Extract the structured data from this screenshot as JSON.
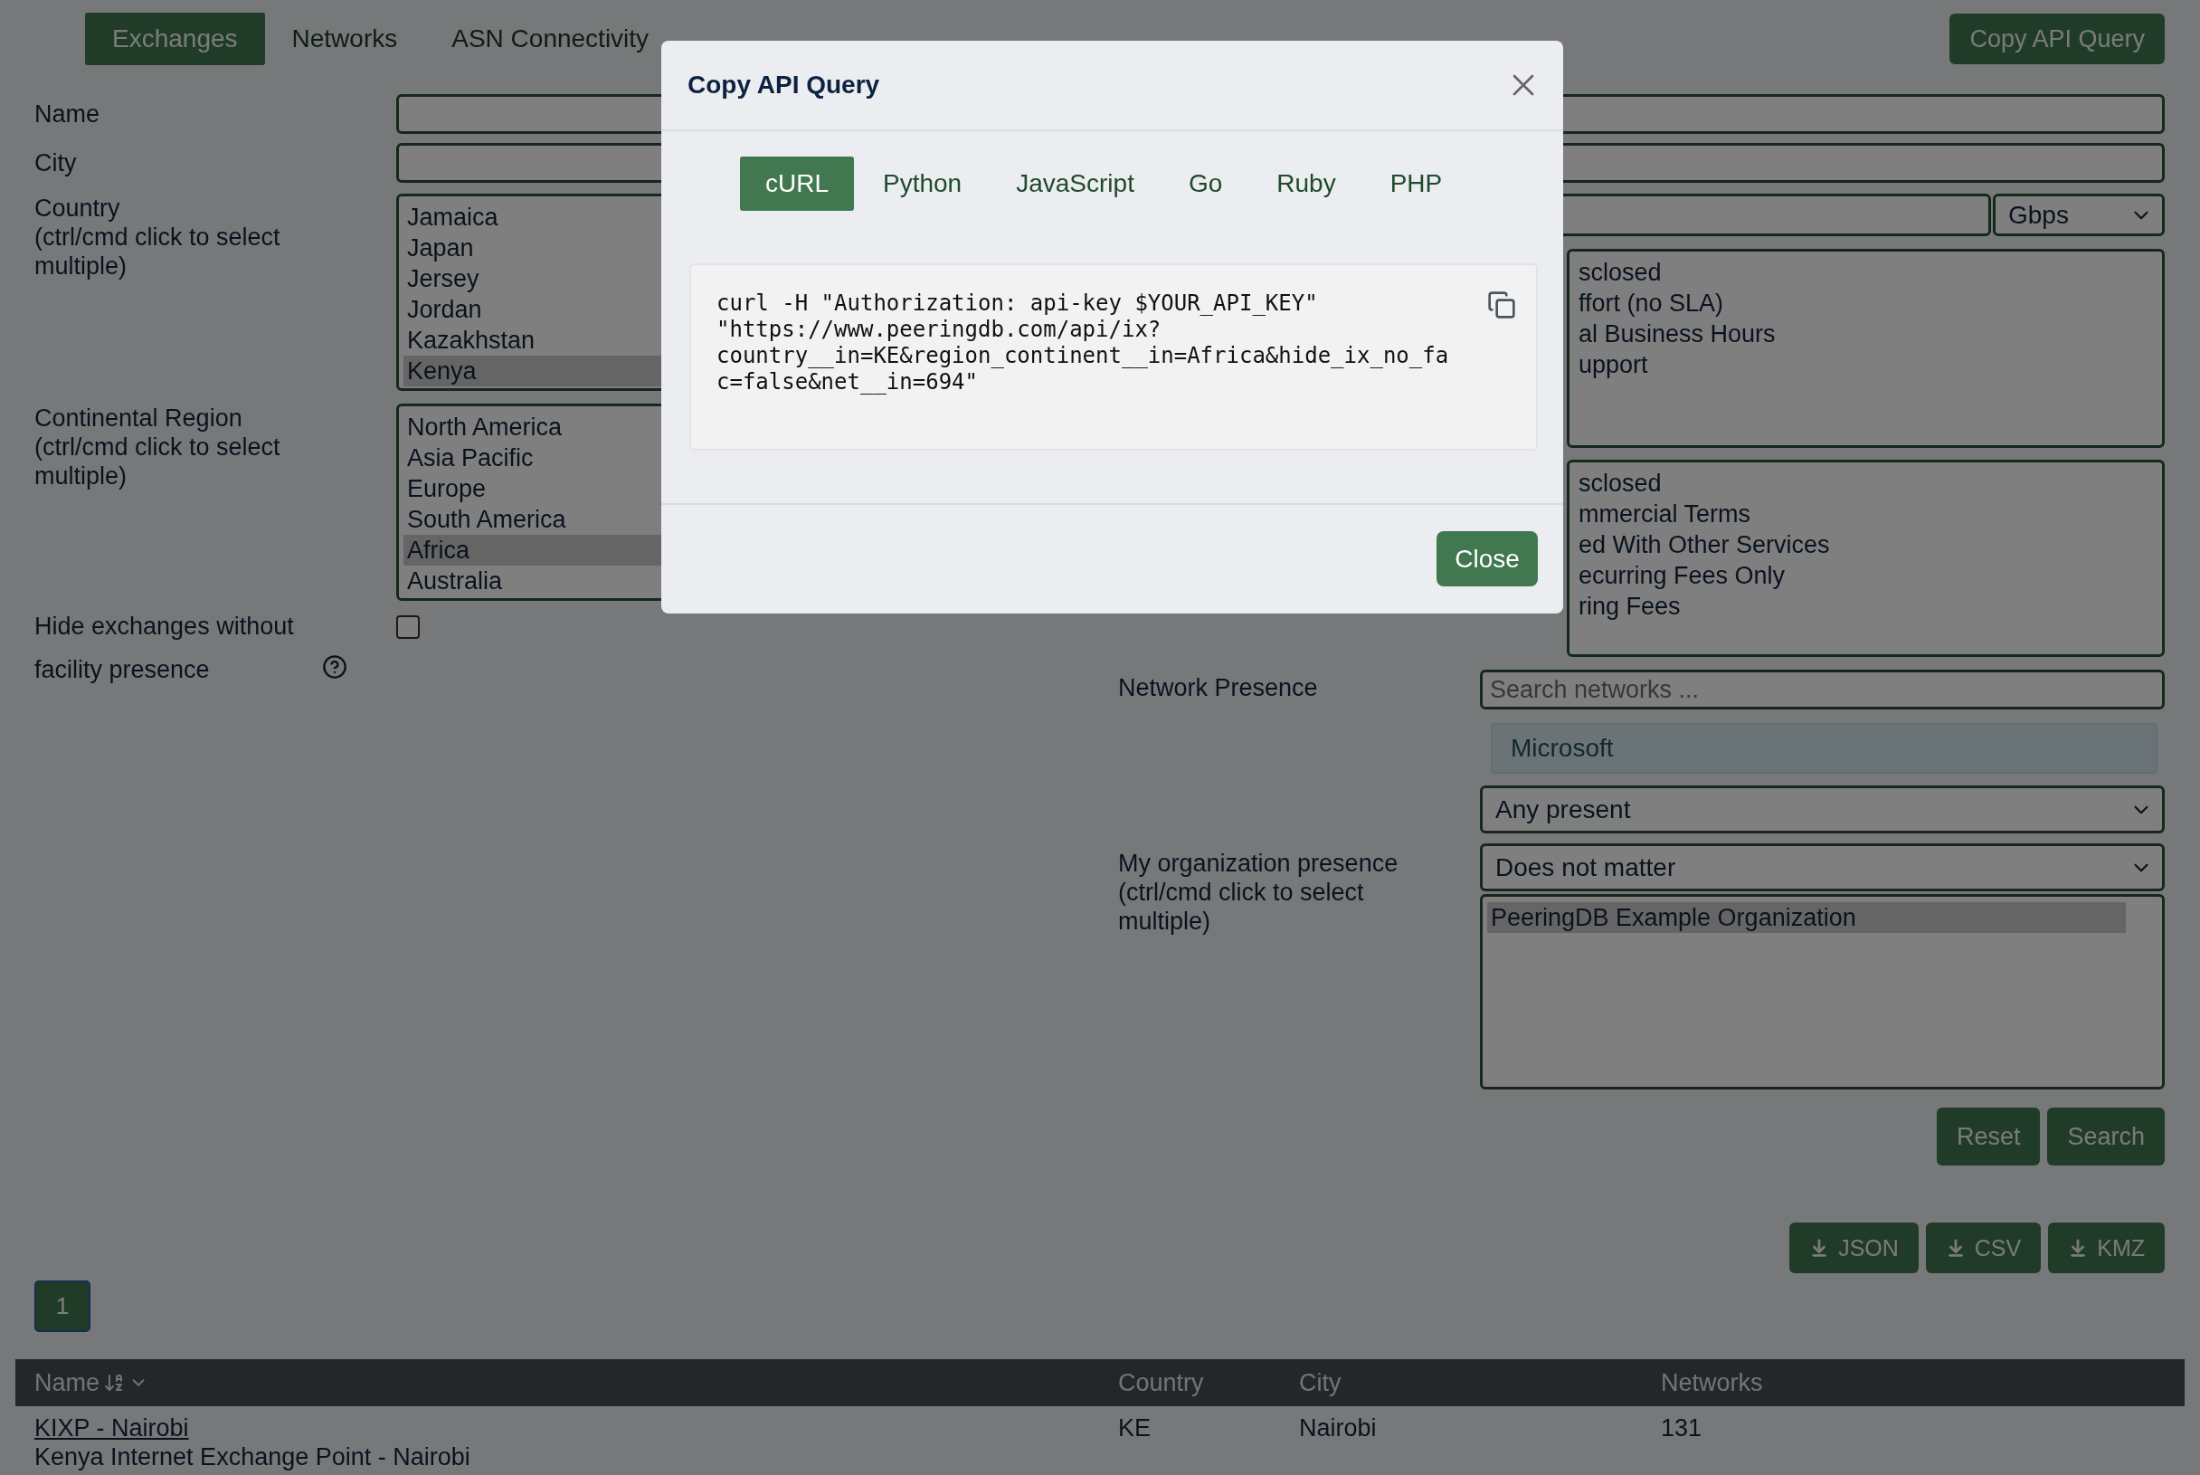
{
  "nav": {
    "tabs": [
      {
        "label": "Exchanges",
        "selected": true
      },
      {
        "label": "Networks",
        "selected": false
      },
      {
        "label": "ASN Connectivity",
        "selected": false
      }
    ],
    "copy_api_button": "Copy API Query"
  },
  "search_form": {
    "name": {
      "label": "Name"
    },
    "city": {
      "label": "City"
    },
    "country": {
      "label": "Country",
      "hint": "(ctrl/cmd click to select multiple)",
      "options": [
        {
          "label": "Jamaica",
          "selected": false
        },
        {
          "label": "Japan",
          "selected": false
        },
        {
          "label": "Jersey",
          "selected": false
        },
        {
          "label": "Jordan",
          "selected": false
        },
        {
          "label": "Kazakhstan",
          "selected": false
        },
        {
          "label": "Kenya",
          "selected": true
        }
      ]
    },
    "region": {
      "label": "Continental Region",
      "hint": "(ctrl/cmd click to select multiple)",
      "options": [
        {
          "label": "North America",
          "selected": false
        },
        {
          "label": "Asia Pacific",
          "selected": false
        },
        {
          "label": "Europe",
          "selected": false
        },
        {
          "label": "South America",
          "selected": false
        },
        {
          "label": "Africa",
          "selected": true
        },
        {
          "label": "Australia",
          "selected": false
        }
      ]
    },
    "hide_no_facility": {
      "label": "Hide exchanges without facility presence",
      "checked": false
    },
    "speed": {
      "unit": "Gbps"
    },
    "service_level": {
      "options": [
        {
          "label": "sclosed",
          "selected": false
        },
        {
          "label": "ffort (no SLA)",
          "selected": false
        },
        {
          "label": "al Business Hours",
          "selected": false
        },
        {
          "label": "upport",
          "selected": false
        }
      ]
    },
    "terms": {
      "options": [
        {
          "label": "sclosed",
          "selected": false
        },
        {
          "label": "mmercial Terms",
          "selected": false
        },
        {
          "label": "ed With Other Services",
          "selected": false
        },
        {
          "label": "ecurring Fees Only",
          "selected": false
        },
        {
          "label": "ring Fees",
          "selected": false
        }
      ]
    },
    "network_presence": {
      "label": "Network Presence",
      "placeholder": "Search networks ...",
      "selected_network": "Microsoft",
      "mode": "Any present"
    },
    "org_presence": {
      "label": "My organization presence",
      "hint": "(ctrl/cmd click to select multiple)",
      "mode": "Does not matter",
      "options": [
        {
          "label": "PeeringDB Example Organization",
          "selected": true
        }
      ]
    },
    "buttons": [
      "Reset",
      "Search"
    ],
    "exports": [
      "JSON",
      "CSV",
      "KMZ"
    ]
  },
  "pagination": [
    {
      "label": "1",
      "selected": true
    }
  ],
  "table": {
    "columns": [
      "Name",
      "Country",
      "City",
      "Networks"
    ],
    "rows": [
      {
        "name": "KIXP - Nairobi",
        "long_name": "Kenya Internet Exchange Point - Nairobi",
        "country": "KE",
        "city": "Nairobi",
        "networks": "131"
      }
    ]
  },
  "modal": {
    "title": "Copy API Query",
    "tabs": [
      {
        "label": "cURL",
        "selected": true
      },
      {
        "label": "Python",
        "selected": false
      },
      {
        "label": "JavaScript",
        "selected": false
      },
      {
        "label": "Go",
        "selected": false
      },
      {
        "label": "Ruby",
        "selected": false
      },
      {
        "label": "PHP",
        "selected": false
      }
    ],
    "code_lines": [
      "curl -H \"Authorization: api-key $YOUR_API_KEY\"",
      "\"https://www.peeringdb.com/api/ix?",
      "country__in=KE&region_continent__in=Africa&hide_ix_no_fa",
      "c=false&net__in=694\""
    ],
    "close_button": "Close"
  }
}
